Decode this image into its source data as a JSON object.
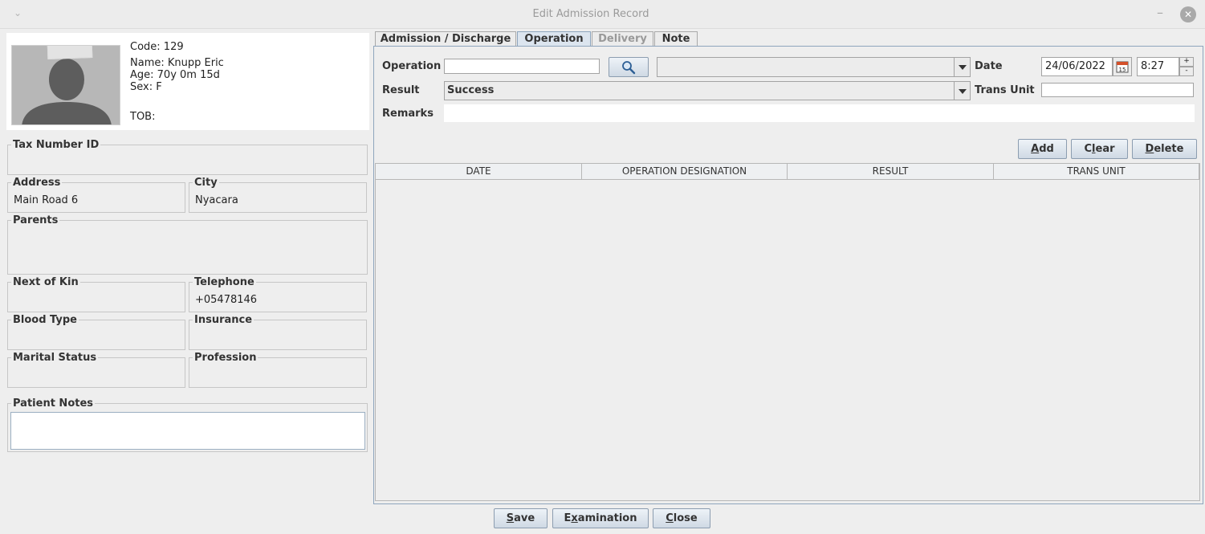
{
  "window": {
    "title": "Edit Admission Record",
    "menu_icon": "chevron-down-icon",
    "minimize_glyph": "–",
    "close_glyph": "✕"
  },
  "patient": {
    "code": "Code: 129",
    "name": "Name: Knupp Eric",
    "age": "Age: 70y 0m 15d",
    "sex": "Sex: F",
    "tob": "TOB:"
  },
  "fields": {
    "tax_number_label": "Tax Number ID",
    "address_label": "Address",
    "address_value": "Main Road 6",
    "city_label": "City",
    "city_value": "Nyacara",
    "parents_label": "Parents",
    "next_of_kin_label": "Next of Kin",
    "telephone_label": "Telephone",
    "telephone_value": "+05478146",
    "blood_type_label": "Blood Type",
    "insurance_label": "Insurance",
    "marital_status_label": "Marital Status",
    "profession_label": "Profession",
    "patient_notes_label": "Patient Notes"
  },
  "tabs": [
    {
      "label": "Admission / Discharge",
      "state": "normal"
    },
    {
      "label": "Operation",
      "state": "active"
    },
    {
      "label": "Delivery",
      "state": "disabled"
    },
    {
      "label": "Note",
      "state": "normal"
    }
  ],
  "operation_form": {
    "operation_label": "Operation",
    "operation_value": "",
    "search_icon": "magnifier-icon",
    "date_label": "Date",
    "date_value": "24/06/2022",
    "calendar_icon": "calendar-icon",
    "calendar_day": "15",
    "time_value": "8:27",
    "spinner_up": "+",
    "spinner_down": "-",
    "result_label": "Result",
    "result_value": "Success",
    "trans_unit_label": "Trans Unit",
    "trans_unit_value": "",
    "remarks_label": "Remarks",
    "remarks_value": ""
  },
  "actions": {
    "add_mnemonic": "A",
    "add_rest": "dd",
    "clear_prefix": "C",
    "clear_mnemonic": "l",
    "clear_rest": "ear",
    "delete_mnemonic": "D",
    "delete_rest": "elete"
  },
  "table": {
    "columns": [
      "DATE",
      "OPERATION DESIGNATION",
      "RESULT",
      "TRANS UNIT"
    ],
    "rows": []
  },
  "footer": {
    "save_mnemonic": "S",
    "save_rest": "ave",
    "examination_prefix": "E",
    "examination_mnemonic": "x",
    "examination_rest": "amination",
    "close_mnemonic": "C",
    "close_rest": "lose"
  },
  "colors": {
    "accent_tab": "#dce5ef",
    "panel_border": "#8ea5bd",
    "background": "#eeeeee"
  }
}
